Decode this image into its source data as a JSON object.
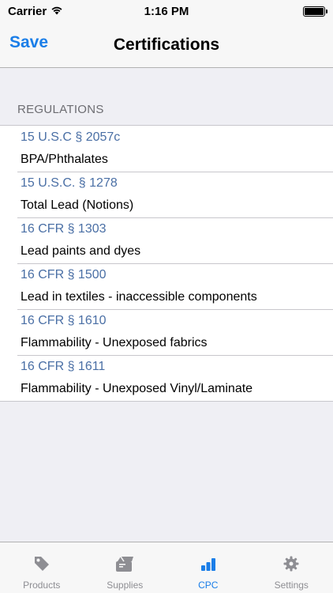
{
  "status_bar": {
    "carrier": "Carrier",
    "time": "1:16 PM",
    "wifi_icon": "wifi-icon",
    "battery_icon": "battery-icon"
  },
  "nav": {
    "left_button": "Save",
    "title": "Certifications"
  },
  "section": {
    "header": "REGULATIONS"
  },
  "regulations": [
    {
      "code": "15 U.S.C § 2057c",
      "description": "BPA/Phthalates"
    },
    {
      "code": "15 U.S.C. § 1278",
      "description": "Total Lead (Notions)"
    },
    {
      "code": "16 CFR § 1303",
      "description": "Lead paints and dyes"
    },
    {
      "code": "16 CFR § 1500",
      "description": "Lead in textiles - inaccessible components"
    },
    {
      "code": "16 CFR § 1610",
      "description": "Flammability - Unexposed fabrics"
    },
    {
      "code": "16 CFR § 1611",
      "description": "Flammability - Unexposed Vinyl/Laminate"
    }
  ],
  "tabs": [
    {
      "label": "Products",
      "icon": "tag-icon",
      "active": false
    },
    {
      "label": "Supplies",
      "icon": "box-icon",
      "active": false
    },
    {
      "label": "CPC",
      "icon": "bar-chart-icon",
      "active": true
    },
    {
      "label": "Settings",
      "icon": "gear-icon",
      "active": false
    }
  ],
  "colors": {
    "accent": "#1a7ee8",
    "code_text": "#4a6fa5",
    "inactive_tab": "#8e8e93"
  }
}
